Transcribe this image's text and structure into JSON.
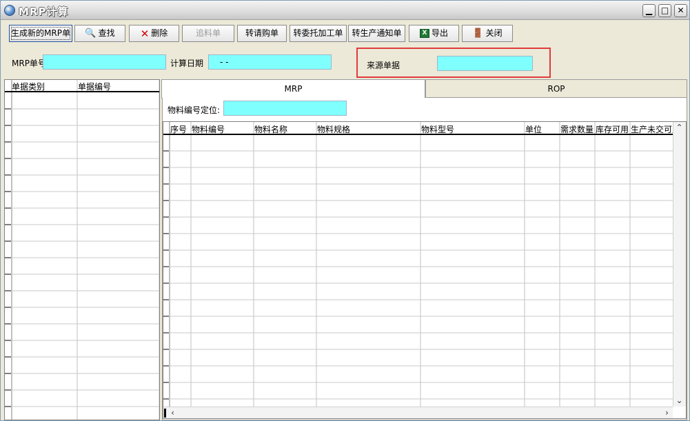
{
  "window": {
    "title": "MRP计算",
    "controls": {
      "minimize": "▁",
      "maximize": "□",
      "close": "✕"
    }
  },
  "toolbar": {
    "buttons": [
      {
        "label": "生成新的MRP单",
        "icon": ""
      },
      {
        "label": "查找",
        "icon": "search-icon"
      },
      {
        "label": "删除",
        "icon": "delete-icon"
      },
      {
        "label": "追料单",
        "icon": ""
      },
      {
        "label": "转请购单",
        "icon": ""
      },
      {
        "label": "转委托加工单",
        "icon": ""
      },
      {
        "label": "转生产通知单",
        "icon": ""
      },
      {
        "label": "导出",
        "icon": "excel-icon"
      },
      {
        "label": "关闭",
        "icon": "exit-icon"
      }
    ]
  },
  "form": {
    "mrp_no_label": "MRP单号",
    "mrp_no_value": "",
    "calc_date_label": "计算日期",
    "calc_date_value": "- -",
    "source_label": "来源单据",
    "source_value": ""
  },
  "left_grid": {
    "columns": [
      "单据类别",
      "单据编号"
    ]
  },
  "tabs": [
    {
      "label": "MRP",
      "active": true
    },
    {
      "label": "ROP",
      "active": false
    }
  ],
  "locate": {
    "label": "物料编号定位:",
    "value": ""
  },
  "right_grid": {
    "columns": [
      "序号",
      "物料编号",
      "物料名称",
      "物料规格",
      "物料型号",
      "单位",
      "需求数量",
      "库存可用",
      "生产未交可用"
    ]
  },
  "colors": {
    "field_bg": "#80ffff",
    "highlight_border": "#e03a3a",
    "window_bg": "#ece9d8"
  }
}
